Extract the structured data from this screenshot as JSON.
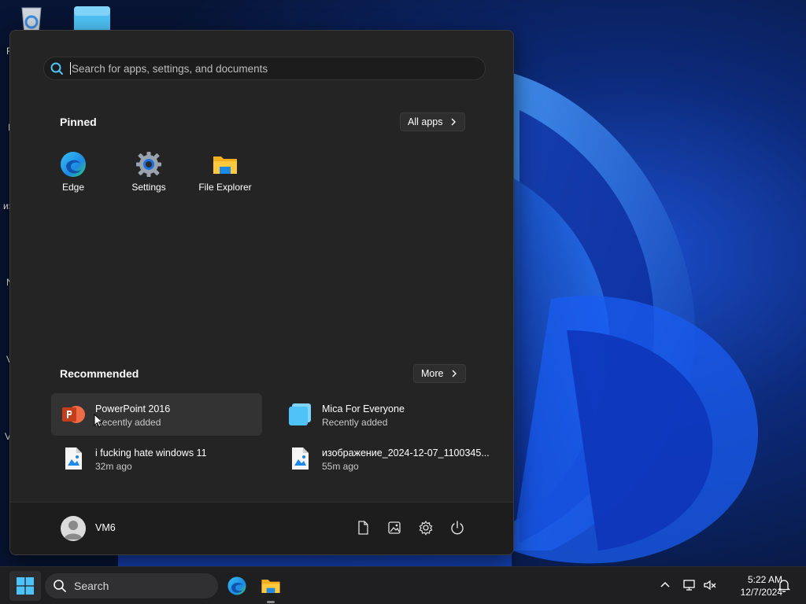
{
  "desktop": {
    "edge_labels": [
      "R",
      "I",
      "из",
      "N",
      "V",
      "V"
    ]
  },
  "start_menu": {
    "search": {
      "placeholder": "Search for apps, settings, and documents"
    },
    "pinned": {
      "title": "Pinned",
      "all_apps_label": "All apps",
      "apps": [
        {
          "label": "Edge",
          "icon": "edge-icon"
        },
        {
          "label": "Settings",
          "icon": "settings-gear-icon"
        },
        {
          "label": "File Explorer",
          "icon": "folder-icon"
        }
      ]
    },
    "recommended": {
      "title": "Recommended",
      "more_label": "More",
      "items": [
        {
          "title": "PowerPoint 2016",
          "subtitle": "Recently added",
          "icon": "powerpoint-icon"
        },
        {
          "title": "Mica For Everyone",
          "subtitle": "Recently added",
          "icon": "mica-app-icon"
        },
        {
          "title": "i fucking hate windows 11",
          "subtitle": "32m ago",
          "icon": "image-file-icon"
        },
        {
          "title": "изображение_2024-12-07_1100345...",
          "subtitle": "55m ago",
          "icon": "image-file-icon"
        }
      ]
    },
    "footer": {
      "user_name": "VM6"
    }
  },
  "taskbar": {
    "search_label": "Search",
    "clock": {
      "time": "5:22 AM",
      "date": "12/7/2024"
    }
  },
  "colors": {
    "accent_blue": "#1e6fe0",
    "menu_bg": "#242424",
    "taskbar_bg": "#1f1f22"
  }
}
